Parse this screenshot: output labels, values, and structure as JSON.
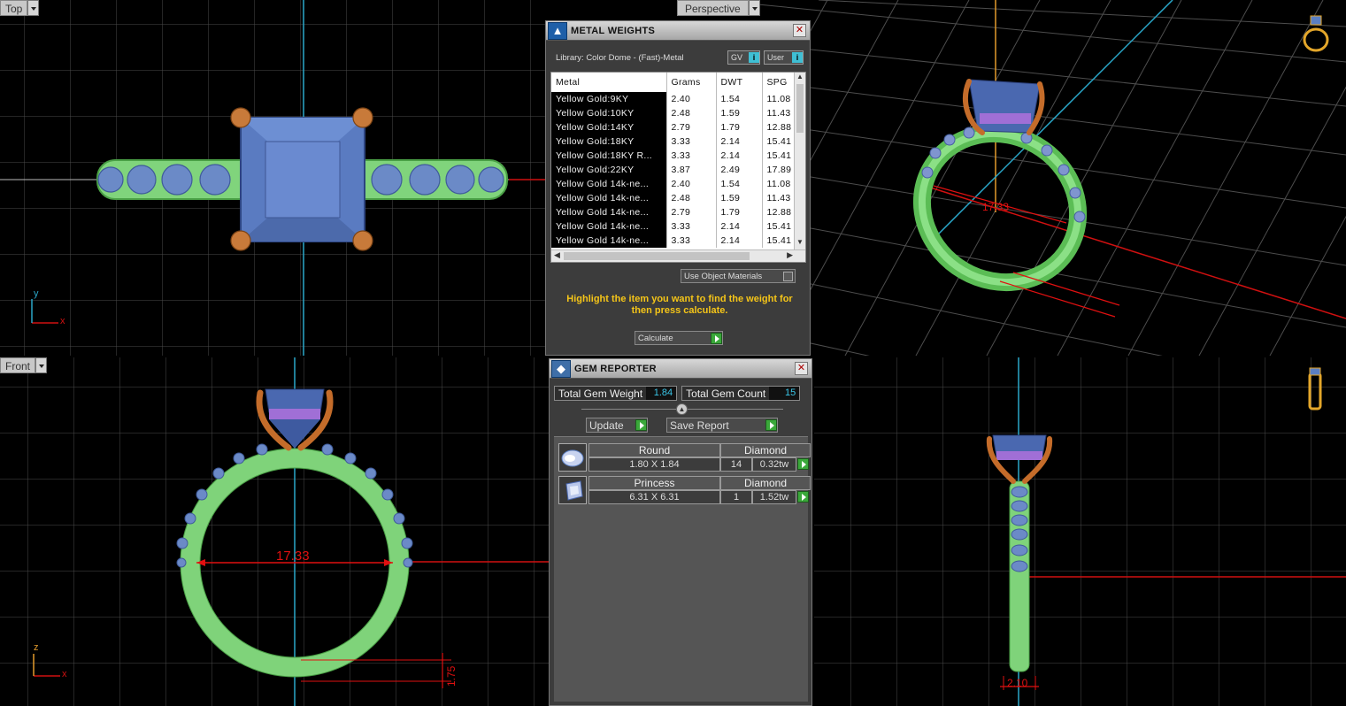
{
  "viewports": {
    "top": {
      "label": "Top",
      "axis_x": "x",
      "axis_y": "y"
    },
    "perspective": {
      "label": "Perspective",
      "dimension": "17.33"
    },
    "front": {
      "label": "Front",
      "axis_x": "x",
      "axis_z": "z",
      "dimension_main": "17.33",
      "dimension_height": "1.75"
    },
    "side": {
      "dimension_width": "2.10"
    }
  },
  "metal_weights": {
    "title": "METAL WEIGHTS",
    "library": "Library: Color Dome - (Fast)-Metal",
    "gv_label": "GV",
    "user_label": "User",
    "columns": [
      "Metal",
      "Grams",
      "DWT",
      "SPG"
    ],
    "rows": [
      [
        "Yellow Gold:9KY",
        "2.40",
        "1.54",
        "11.08"
      ],
      [
        "Yellow Gold:10KY",
        "2.48",
        "1.59",
        "11.43"
      ],
      [
        "Yellow Gold:14KY",
        "2.79",
        "1.79",
        "12.88"
      ],
      [
        "Yellow Gold:18KY",
        "3.33",
        "2.14",
        "15.41"
      ],
      [
        "Yellow Gold:18KY R...",
        "3.33",
        "2.14",
        "15.41"
      ],
      [
        "Yellow Gold:22KY",
        "3.87",
        "2.49",
        "17.89"
      ],
      [
        "Yellow Gold 14k-ne...",
        "2.40",
        "1.54",
        "11.08"
      ],
      [
        "Yellow Gold 14k-ne...",
        "2.48",
        "1.59",
        "11.43"
      ],
      [
        "Yellow Gold 14k-ne...",
        "2.79",
        "1.79",
        "12.88"
      ],
      [
        "Yellow Gold 14k-ne...",
        "3.33",
        "2.14",
        "15.41"
      ],
      [
        "Yellow Gold 14k-ne...",
        "3.33",
        "2.14",
        "15.41"
      ]
    ],
    "use_object_materials": "Use Object Materials",
    "instruction": "Highlight the item you want to find the weight for then press calculate.",
    "calculate_label": "Calculate"
  },
  "gem_reporter": {
    "title": "GEM REPORTER",
    "total_weight_label": "Total Gem Weight",
    "total_weight_value": "1.84",
    "total_count_label": "Total Gem Count",
    "total_count_value": "15",
    "update_label": "Update",
    "save_report_label": "Save Report",
    "gems": [
      {
        "icon": "round-gem-icon",
        "shape": "Round",
        "material": "Diamond",
        "size": "1.80 X 1.84",
        "count": "14",
        "weight": "0.32tw"
      },
      {
        "icon": "princess-gem-icon",
        "shape": "Princess",
        "material": "Diamond",
        "size": "6.31 X 6.31",
        "count": "1",
        "weight": "1.52tw"
      }
    ]
  },
  "colors": {
    "grid": "#4a4a4a",
    "panel_bg": "#3c3c3c",
    "ring_green": "#7fd37a",
    "gem_blue": "#5b7fc2",
    "prong_copper": "#c06a2a",
    "dimension_red": "#e01010",
    "instruction_yellow": "#f5c518",
    "value_cyan": "#39c6e8"
  }
}
